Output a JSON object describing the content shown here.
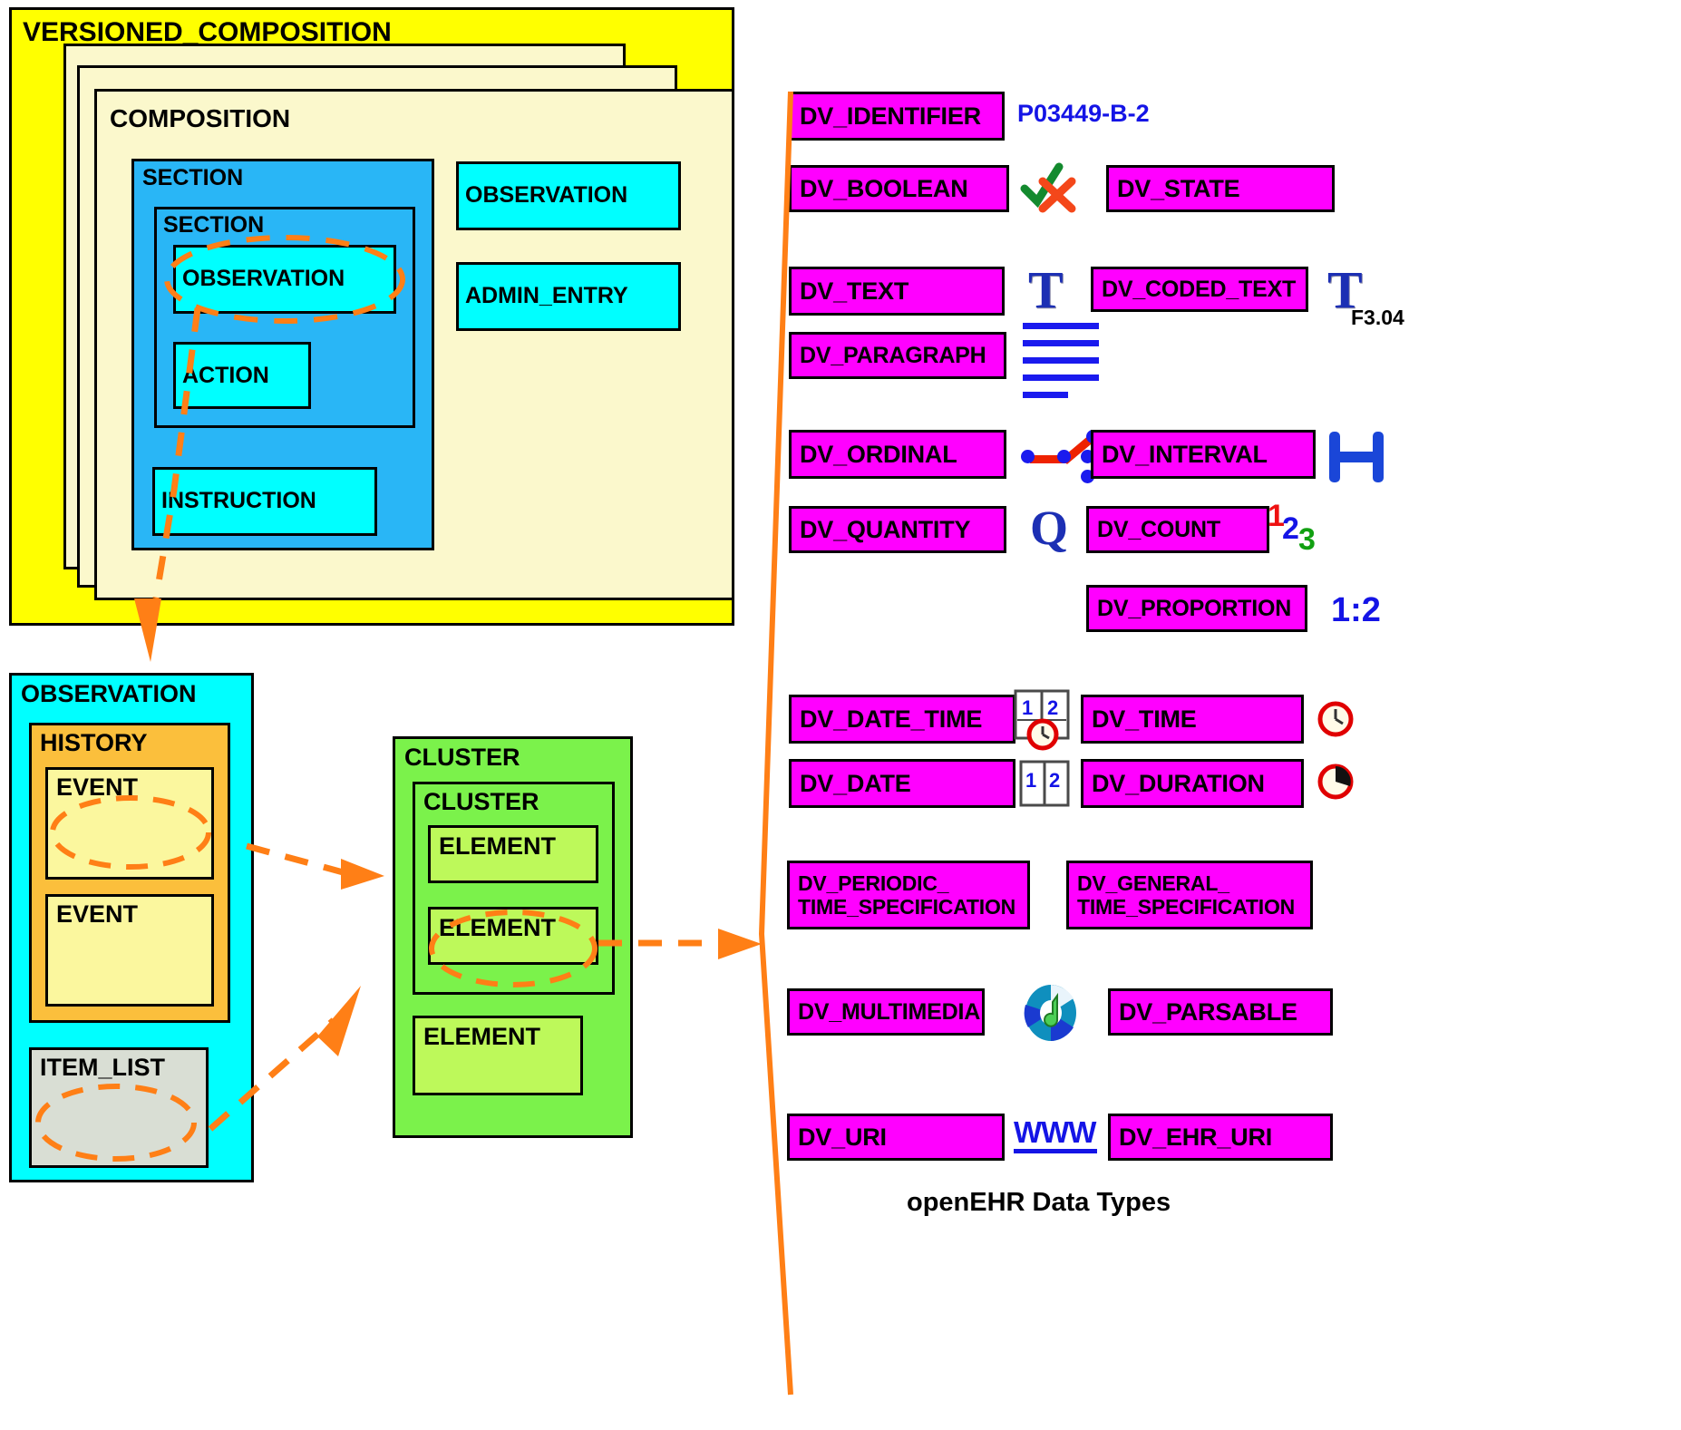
{
  "diagram": {
    "caption": "openEHR Data Types"
  },
  "left": {
    "versioned_composition": "VERSIONED_COMPOSITION",
    "composition": "COMPOSITION",
    "section_outer": "SECTION",
    "section_inner": "SECTION",
    "observation_inner": "OBSERVATION",
    "action": "ACTION",
    "instruction": "INSTRUCTION",
    "observation_right": "OBSERVATION",
    "admin_entry": "ADMIN_ENTRY"
  },
  "observation_detail": {
    "observation": "OBSERVATION",
    "history": "HISTORY",
    "event_1": "EVENT",
    "event_2": "EVENT",
    "item_list": "ITEM_LIST"
  },
  "cluster_detail": {
    "cluster_outer": "CLUSTER",
    "cluster_inner": "CLUSTER",
    "element_1": "ELEMENT",
    "element_2": "ELEMENT",
    "element_3": "ELEMENT"
  },
  "data_types": {
    "dv_identifier": "DV_IDENTIFIER",
    "dv_identifier_sample": "P03449-B-2",
    "dv_boolean": "DV_BOOLEAN",
    "dv_state": "DV_STATE",
    "dv_text": "DV_TEXT",
    "dv_coded_text": "DV_CODED_TEXT",
    "dv_coded_text_sample": "F3.04",
    "dv_paragraph": "DV_PARAGRAPH",
    "dv_ordinal": "DV_ORDINAL",
    "dv_interval": "DV_INTERVAL",
    "dv_quantity": "DV_QUANTITY",
    "dv_quantity_sample": "Q",
    "dv_count": "DV_COUNT",
    "dv_count_sample_1": "1",
    "dv_count_sample_2": "2",
    "dv_count_sample_3": "3",
    "dv_proportion": "DV_PROPORTION",
    "dv_proportion_sample": "1:2",
    "dv_date_time": "DV_DATE_TIME",
    "dv_time": "DV_TIME",
    "dv_date": "DV_DATE",
    "dv_duration": "DV_DURATION",
    "dv_periodic_time_spec_l1": "DV_PERIODIC_",
    "dv_periodic_time_spec_l2": "TIME_SPECIFICATION",
    "dv_general_time_spec_l1": "DV_GENERAL_",
    "dv_general_time_spec_l2": "TIME_SPECIFICATION",
    "dv_multimedia": "DV_MULTIMEDIA",
    "dv_parsable": "DV_PARSABLE",
    "dv_uri": "DV_URI",
    "dv_uri_sample": "WWW",
    "dv_ehr_uri": "DV_EHR_URI",
    "calendar_digit_1": "1",
    "calendar_digit_2": "2"
  },
  "colors": {
    "magenta": "#ff00ff",
    "yellow": "#ffff00",
    "cream": "#fbf8cc",
    "skyblue": "#29b6f6",
    "cyan": "#00ffff",
    "amber": "#fbbf3c",
    "pale_yellow": "#fbf79e",
    "gray": "#d9ded4",
    "green": "#7bf24b",
    "light_green": "#bdf95a",
    "orange_link": "#ff7f16",
    "blue_accent": "#1414e6",
    "check_green": "#138a2e",
    "cross_red": "#f4471a"
  }
}
